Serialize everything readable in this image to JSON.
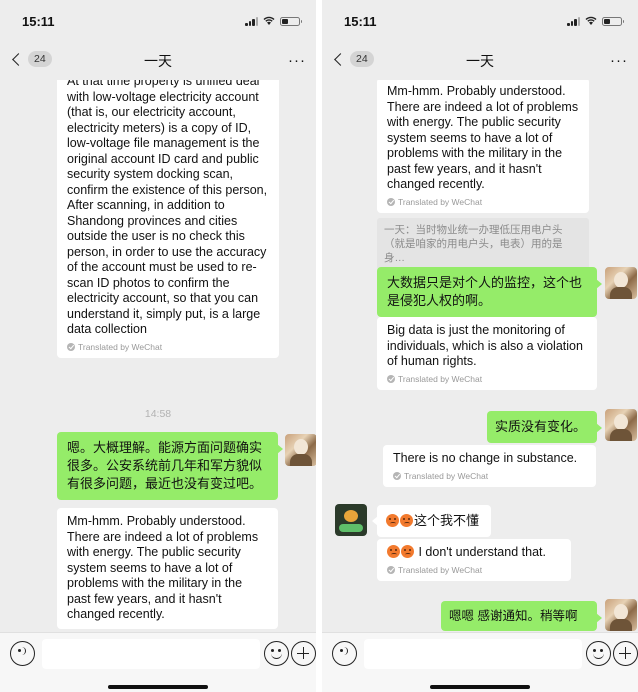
{
  "status": {
    "time": "15:11"
  },
  "header": {
    "back_badge": "24",
    "title": "一天",
    "more": "···"
  },
  "left_chat": {
    "msg1": {
      "text": "At that time property is unified deal with low-voltage electricity account (that is, our electricity account, electricity meters) is a copy of ID, low-voltage file management is the original account ID card and public security system docking scan, confirm the existence of this person, After scanning, in addition to Shandong provinces and cities outside the user is no check this person, in order to use the accuracy of the account must be used to re-scan ID photos to confirm the electricity account, so that you can understand it, simply put, is a large data collection",
      "translated": "Translated by WeChat"
    },
    "timestamp": "14:58",
    "msg2": {
      "text": "嗯。大概理解。能源方面问题确实很多。公安系统前几年和军方貌似有很多问题，最近也没有变过吧。"
    },
    "msg3": {
      "text": "Mm-hmm. Probably understood. There are indeed a lot of problems with energy. The public security system seems to have a lot of problems with the military in the past few years, and it hasn't changed recently."
    }
  },
  "right_chat": {
    "msg1": {
      "text": "Mm-hmm. Probably understood. There are indeed a lot of problems with energy. The public security system seems to have a lot of problems with the military in the past few years, and it hasn't changed recently.",
      "translated": "Translated by WeChat"
    },
    "quote": "一天：当时物业统一办理低压用电户头（就是咱家的用电户头，电表）用的是身…",
    "msg2": {
      "text": "大数据只是对个人的监控，这个也是侵犯人权的啊。"
    },
    "msg3": {
      "text": "Big data is just the monitoring of individuals, which is also a violation of human rights.",
      "translated": "Translated by WeChat"
    },
    "msg4": {
      "text": "实质没有变化。"
    },
    "msg5": {
      "text": "There is no change in substance.",
      "translated": "Translated by WeChat"
    },
    "msg6": {
      "text": "这个我不懂"
    },
    "msg7": {
      "text": "I don't understand that.",
      "translated": "Translated by WeChat"
    },
    "msg8": {
      "text": "嗯嗯 感谢通知。稍等啊"
    }
  },
  "icons": {
    "voice": "voice-icon",
    "emoji": "smile-icon",
    "plus": "plus-icon",
    "back": "chevron-left-icon"
  }
}
